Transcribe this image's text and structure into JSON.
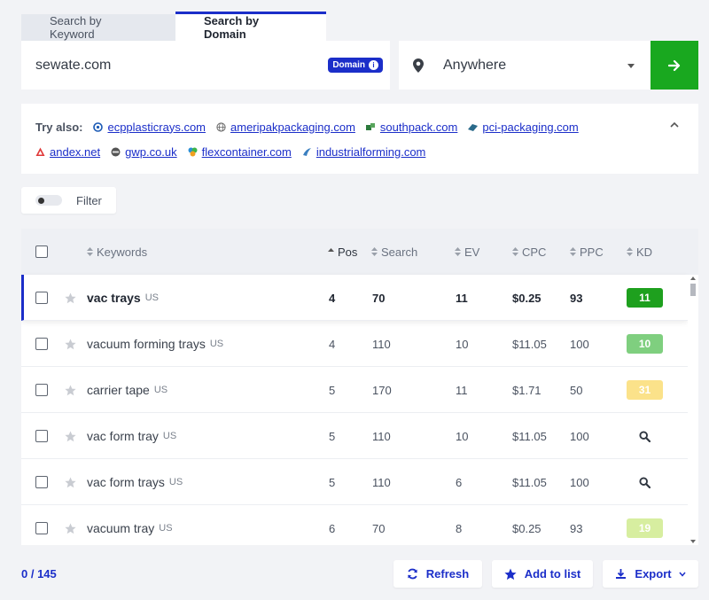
{
  "tabs": [
    {
      "label": "Search by Keyword"
    },
    {
      "label": "Search by Domain"
    }
  ],
  "search": {
    "domain_value": "sewate.com",
    "domain_badge": "Domain",
    "info_glyph": "i",
    "location": "Anywhere"
  },
  "try_also": {
    "label": "Try also:",
    "links": [
      {
        "text": "ecpplasticrays.com",
        "icon": "favicon-ecp"
      },
      {
        "text": "ameripakpackaging.com",
        "icon": "favicon-ameripak"
      },
      {
        "text": "southpack.com",
        "icon": "favicon-southpack"
      },
      {
        "text": "pci-packaging.com",
        "icon": "favicon-pci"
      },
      {
        "text": "andex.net",
        "icon": "favicon-andex"
      },
      {
        "text": "gwp.co.uk",
        "icon": "favicon-gwp"
      },
      {
        "text": "flexcontainer.com",
        "icon": "favicon-flexcontainer"
      },
      {
        "text": "industrialforming.com",
        "icon": "favicon-industrialforming"
      }
    ]
  },
  "filter": {
    "label": "Filter"
  },
  "table": {
    "columns": {
      "keywords": "Keywords",
      "pos": "Pos",
      "search": "Search",
      "ev": "EV",
      "cpc": "CPC",
      "ppc": "PPC",
      "kd": "KD"
    },
    "rows": [
      {
        "keyword": "vac trays",
        "country": "US",
        "pos": "4",
        "search": "70",
        "ev": "11",
        "cpc": "$0.25",
        "ppc": "93",
        "kd": "11",
        "kd_color": "#1ea01e"
      },
      {
        "keyword": "vacuum forming trays",
        "country": "US",
        "pos": "4",
        "search": "110",
        "ev": "10",
        "cpc": "$11.05",
        "ppc": "100",
        "kd": "10",
        "kd_color": "#7fcf7f"
      },
      {
        "keyword": "carrier tape",
        "country": "US",
        "pos": "5",
        "search": "170",
        "ev": "11",
        "cpc": "$1.71",
        "ppc": "50",
        "kd": "31",
        "kd_color": "#fbe28a"
      },
      {
        "keyword": "vac form tray",
        "country": "US",
        "pos": "5",
        "search": "110",
        "ev": "10",
        "cpc": "$11.05",
        "ppc": "100",
        "kd": "",
        "kd_color": ""
      },
      {
        "keyword": "vac form trays",
        "country": "US",
        "pos": "5",
        "search": "110",
        "ev": "6",
        "cpc": "$11.05",
        "ppc": "100",
        "kd": "",
        "kd_color": ""
      },
      {
        "keyword": "vacuum tray",
        "country": "US",
        "pos": "6",
        "search": "70",
        "ev": "8",
        "cpc": "$0.25",
        "ppc": "93",
        "kd": "19",
        "kd_color": "#d7eea0"
      }
    ]
  },
  "footer": {
    "count": "0 / 145",
    "refresh": "Refresh",
    "add_to_list": "Add to list",
    "export": "Export"
  },
  "colors": {
    "accent": "#1b2ec9",
    "go": "#19a81f"
  }
}
